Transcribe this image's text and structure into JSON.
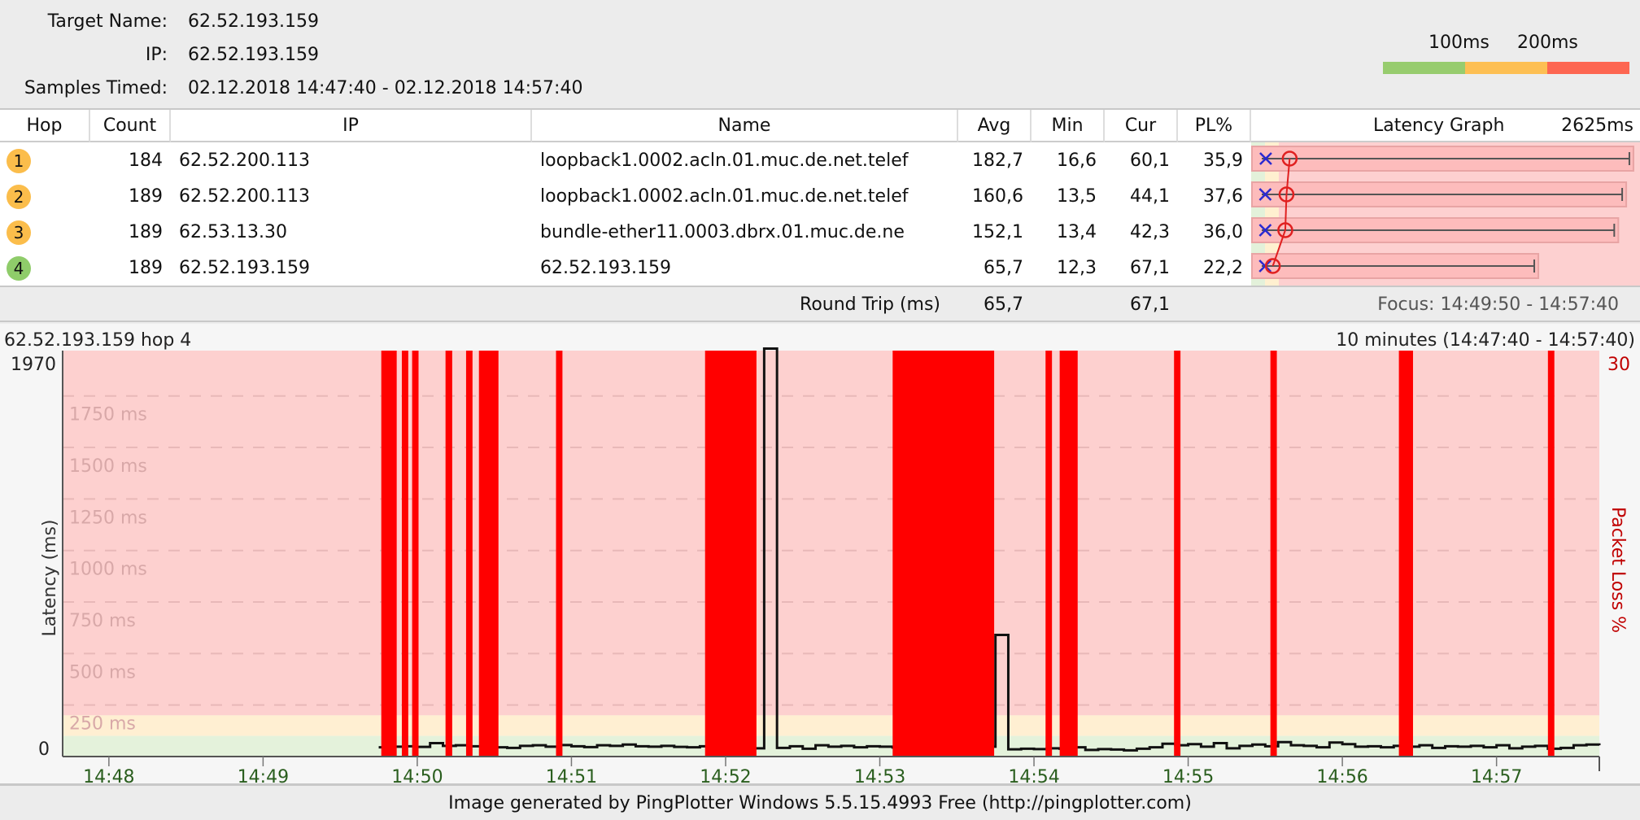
{
  "header": {
    "target_name_label": "Target Name:",
    "target_name": "62.52.193.159",
    "ip_label": "IP:",
    "ip": "62.52.193.159",
    "samples_label": "Samples Timed:",
    "samples": "02.12.2018 14:47:40 - 02.12.2018 14:57:40",
    "legend": {
      "label_100": "100ms",
      "label_200": "200ms",
      "colors": [
        "#97cc6e",
        "#fdbf53",
        "#fd6651"
      ]
    }
  },
  "table": {
    "columns": {
      "hop": "Hop",
      "count": "Count",
      "ip": "IP",
      "name": "Name",
      "avg": "Avg",
      "min": "Min",
      "cur": "Cur",
      "pl": "PL%",
      "graph": "Latency Graph",
      "graph_max": "2625ms"
    },
    "graph_scale_ms": 2625,
    "rows": [
      {
        "hop": "1",
        "count": "184",
        "ip": "62.52.200.113",
        "name": "loopback1.0002.acln.01.muc.de.net.telef",
        "avg": "182,7",
        "min": "16,6",
        "cur": "60,1",
        "pl": "35,9",
        "avg_ms": 182.7,
        "min_ms": 16.6,
        "max_ms": 2540,
        "color": "#fbbd4b"
      },
      {
        "hop": "2",
        "count": "189",
        "ip": "62.52.200.113",
        "name": "loopback1.0002.acln.01.muc.de.net.telef",
        "avg": "160,6",
        "min": "13,5",
        "cur": "44,1",
        "pl": "37,6",
        "avg_ms": 160.6,
        "min_ms": 13.5,
        "max_ms": 2490,
        "color": "#fbbd4b"
      },
      {
        "hop": "3",
        "count": "189",
        "ip": "62.53.13.30",
        "name": "bundle-ether11.0003.dbrx.01.muc.de.ne",
        "avg": "152,1",
        "min": "13,4",
        "cur": "42,3",
        "pl": "36,0",
        "avg_ms": 152.1,
        "min_ms": 13.4,
        "max_ms": 2435,
        "color": "#fbbd4b"
      },
      {
        "hop": "4",
        "count": "189",
        "ip": "62.52.193.159",
        "name": "62.52.193.159",
        "avg": "65,7",
        "min": "12,3",
        "cur": "67,1",
        "pl": "22,2",
        "avg_ms": 65.7,
        "min_ms": 12.3,
        "max_ms": 1880,
        "color": "#8fcc6a"
      }
    ],
    "round_trip_label": "Round Trip (ms)",
    "round_trip_avg": "65,7",
    "round_trip_cur": "67,1",
    "focus": "Focus: 14:49:50 - 14:57:40"
  },
  "graph": {
    "title": "62.52.193.159 hop 4",
    "range": "10 minutes (14:47:40 - 14:57:40)",
    "y_top_label": "1970",
    "y_zero_label": "0",
    "y_axis_label": "Latency (ms)",
    "right_top_label": "30",
    "right_axis_label": "Packet Loss %",
    "grid_labels": [
      "250 ms",
      "500 ms",
      "750 ms",
      "1000 ms",
      "1250 ms",
      "1500 ms",
      "1750 ms"
    ],
    "x_labels": [
      "14:48",
      "14:49",
      "14:50",
      "14:51",
      "14:52",
      "14:53",
      "14:54",
      "14:55",
      "14:56",
      "14:57"
    ]
  },
  "chart_data": {
    "type": "line",
    "x_unit": "seconds since 14:47:40",
    "xlim": [
      2,
      600
    ],
    "ylim": [
      0,
      1970
    ],
    "zones_ms": {
      "green_max": 100,
      "yellow_max": 200
    },
    "grid_ms": [
      250,
      500,
      750,
      1000,
      1250,
      1500,
      1750
    ],
    "x_ticks_s": [
      20,
      80,
      140,
      200,
      260,
      320,
      380,
      440,
      500,
      560
    ],
    "latency": {
      "start_s": 125,
      "step_s": 5,
      "values": [
        45,
        48,
        50,
        47,
        65,
        52,
        55,
        50,
        58,
        45,
        42,
        52,
        55,
        48,
        56,
        50,
        46,
        55,
        52,
        58,
        50,
        48,
        52,
        47,
        45,
        50,
        52,
        48,
        44,
        40,
        1980,
        42,
        50,
        38,
        55,
        48,
        52,
        45,
        50,
        48,
        44,
        50,
        52,
        46,
        40,
        45,
        50,
        48,
        590,
        35,
        38,
        36,
        40,
        38,
        45,
        32,
        36,
        34,
        30,
        38,
        45,
        62,
        55,
        60,
        48,
        65,
        40,
        52,
        58,
        50,
        70,
        55,
        52,
        45,
        68,
        60,
        48,
        50,
        45,
        52,
        48,
        55,
        42,
        50,
        48,
        52,
        45,
        55,
        40,
        48,
        52,
        38,
        42,
        55,
        58,
        55
      ]
    },
    "packet_loss_periods_s": [
      [
        126,
        132
      ],
      [
        134,
        136.5
      ],
      [
        138,
        140.5
      ],
      [
        151,
        153.6
      ],
      [
        159,
        161.5
      ],
      [
        164,
        171.6
      ],
      [
        194,
        196.5
      ],
      [
        252,
        272
      ],
      [
        325,
        364.5
      ],
      [
        384.5,
        387
      ],
      [
        390,
        397
      ],
      [
        434.5,
        437
      ],
      [
        472,
        474.5
      ],
      [
        522,
        527.5
      ],
      [
        580,
        582.5
      ]
    ]
  },
  "footer": {
    "text": "Image generated by PingPlotter Windows 5.5.15.4993 Free (http://pingplotter.com)"
  }
}
